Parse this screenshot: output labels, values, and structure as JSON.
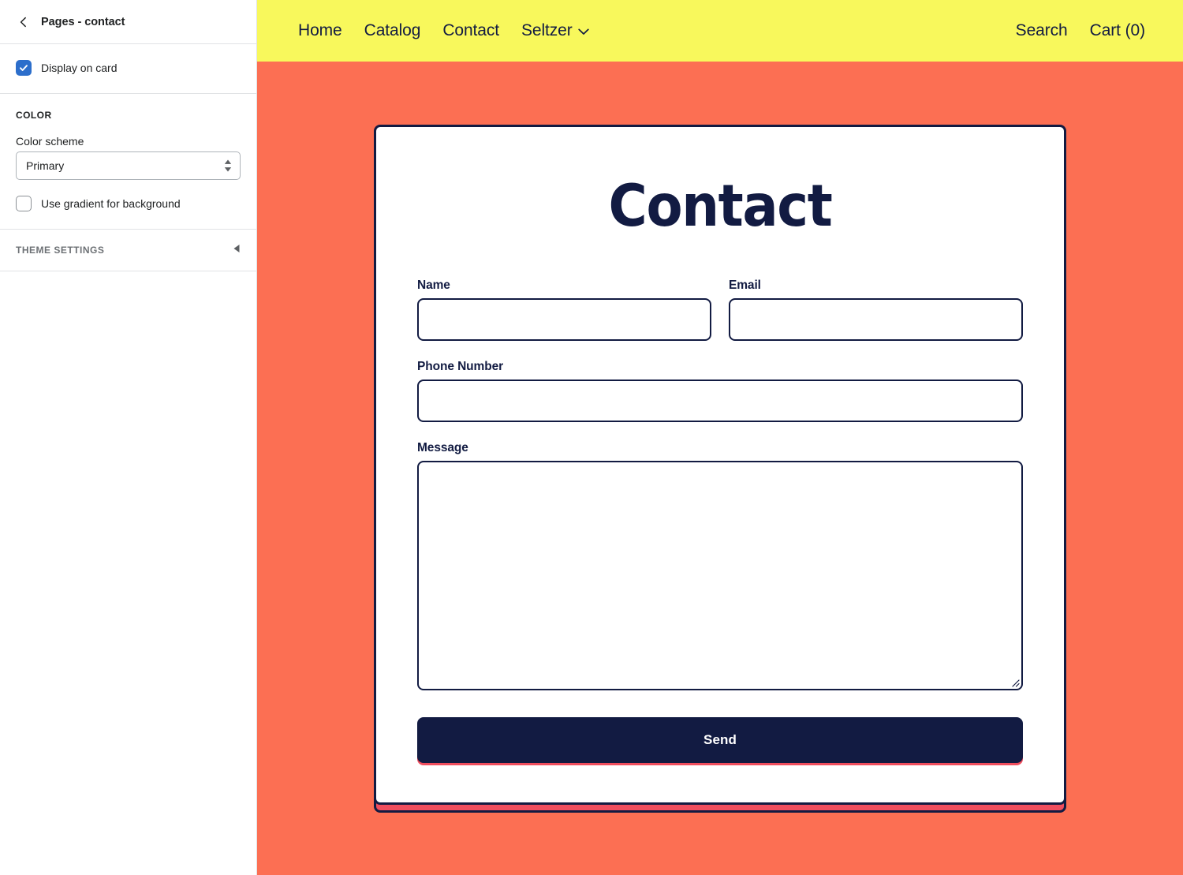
{
  "sidebar": {
    "back_icon": "chevron-left-icon",
    "title": "Pages - contact",
    "display_on_card": {
      "label": "Display on card",
      "checked": true,
      "icon": "check-icon"
    },
    "color_section": {
      "heading": "COLOR",
      "color_scheme_label": "Color scheme",
      "color_scheme_value": "Primary",
      "color_scheme_options": [
        "Primary"
      ],
      "select_icon": "chevron-up-down-icon",
      "use_gradient": {
        "label": "Use gradient for background",
        "checked": false
      }
    },
    "theme_settings": {
      "label": "THEME SETTINGS",
      "icon": "triangle-left-icon"
    }
  },
  "preview": {
    "nav": {
      "background": "#f8f85c",
      "text_color": "#121b42",
      "left_links": [
        {
          "label": "Home"
        },
        {
          "label": "Catalog"
        },
        {
          "label": "Contact"
        },
        {
          "label": "Seltzer",
          "caret": true,
          "caret_icon": "chevron-down-icon"
        }
      ],
      "right_links": [
        {
          "label": "Search"
        },
        {
          "label": "Cart (0)"
        }
      ]
    },
    "background_color": "#fc6f53",
    "card": {
      "title": "Contact",
      "border_color": "#121b42",
      "shadow_color": "#f04e5e",
      "fields": [
        {
          "name": "name",
          "label": "Name",
          "value": "",
          "placeholder": ""
        },
        {
          "name": "email",
          "label": "Email",
          "value": "",
          "placeholder": ""
        },
        {
          "name": "phone",
          "label": "Phone Number",
          "value": "",
          "placeholder": ""
        },
        {
          "name": "message",
          "label": "Message",
          "value": "",
          "placeholder": ""
        }
      ],
      "submit_label": "Send"
    }
  }
}
